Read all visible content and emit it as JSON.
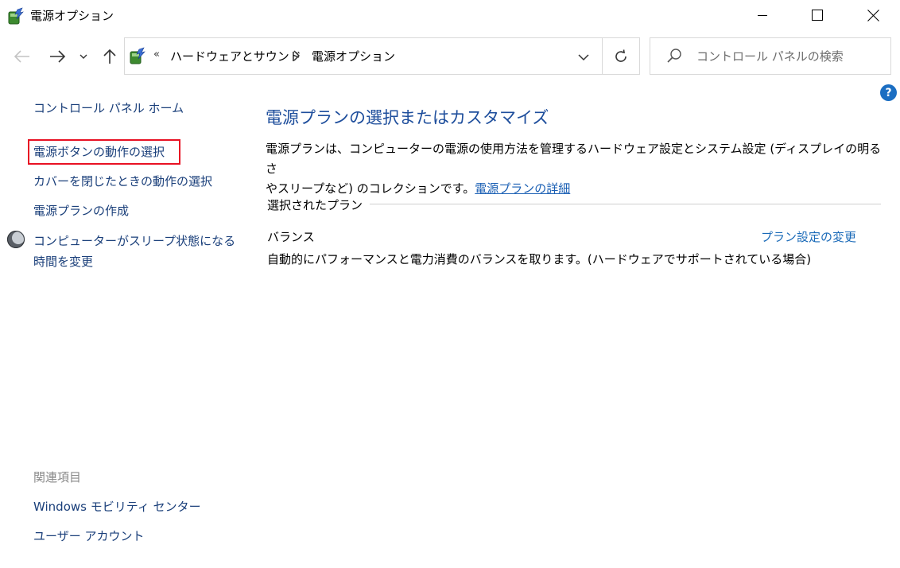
{
  "window": {
    "title": "電源オプション"
  },
  "navigation": {
    "address": {
      "separator": "«",
      "crumbs": [
        "ハードウェアとサウンド",
        "電源オプション"
      ]
    },
    "search": {
      "placeholder": "コントロール パネルの検索"
    },
    "help_label": "?"
  },
  "sidebar": {
    "items": [
      {
        "label": "コントロール パネル ホーム"
      },
      {
        "label": "電源ボタンの動作の選択"
      },
      {
        "label": "カバーを閉じたときの動作の選択"
      },
      {
        "label": "電源プランの作成"
      },
      {
        "label_line1": "コンピューターがスリープ状態になる",
        "label_line2": "時間を変更"
      }
    ],
    "related": {
      "heading": "関連項目",
      "items": [
        {
          "label": "Windows モビリティ センター"
        },
        {
          "label": "ユーザー アカウント"
        }
      ]
    }
  },
  "main": {
    "title": "電源プランの選択またはカスタマイズ",
    "description_line1": "電源プランは、コンピューターの電源の使用方法を管理するハードウェア設定とシステム設定 (ディスプレイの明るさ",
    "description_line2": "やスリープなど) のコレクションです。",
    "description_link": "電源プランの詳細",
    "group_label": "選択されたプラン",
    "plan": {
      "name": "バランス",
      "change_link": "プラン設定の変更",
      "description": "自動的にパフォーマンスと電力消費のバランスを取ります。(ハードウェアでサポートされている場合)"
    }
  },
  "colors": {
    "link": "#1a3f7a",
    "title_blue": "#1e4e9c",
    "highlight_red": "#e81123",
    "help_blue": "#1b6ec2"
  }
}
